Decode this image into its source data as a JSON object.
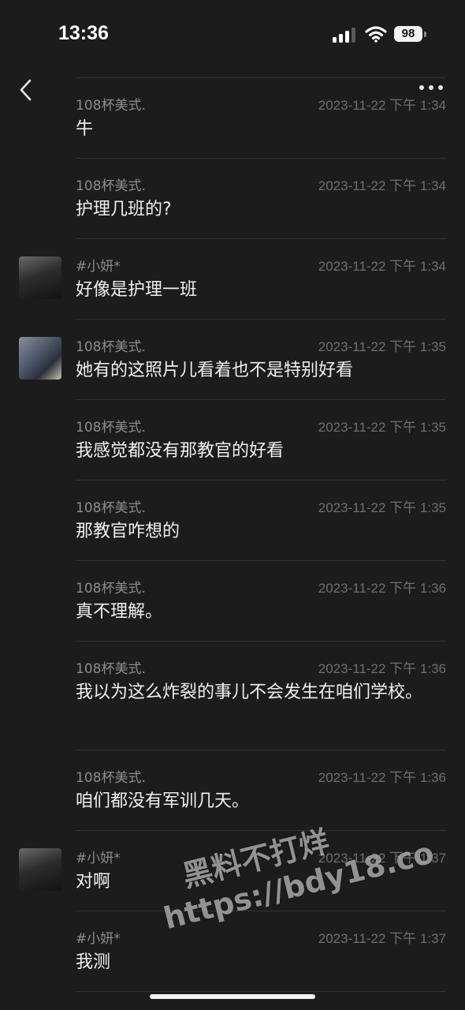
{
  "status": {
    "time": "13:36",
    "battery": "98"
  },
  "messages": [
    {
      "name": "108杯美式.",
      "time": "2023-11-22 下午 1:34",
      "text": "牛",
      "avatar": ""
    },
    {
      "name": "108杯美式.",
      "time": "2023-11-22 下午 1:34",
      "text": "护理几班的?",
      "avatar": ""
    },
    {
      "name": "#小妍*",
      "time": "2023-11-22 下午 1:34",
      "text": "好像是护理一班",
      "avatar": "dark-portrait"
    },
    {
      "name": "108杯美式.",
      "time": "2023-11-22 下午 1:35",
      "text": "她有的这照片儿看着也不是特别好看",
      "avatar": "photo-portrait"
    },
    {
      "name": "108杯美式.",
      "time": "2023-11-22 下午 1:35",
      "text": "我感觉都没有那教官的好看",
      "avatar": ""
    },
    {
      "name": "108杯美式.",
      "time": "2023-11-22 下午 1:35",
      "text": "那教官咋想的",
      "avatar": ""
    },
    {
      "name": "108杯美式.",
      "time": "2023-11-22 下午 1:36",
      "text": "真不理解。",
      "avatar": ""
    },
    {
      "name": "108杯美式.",
      "time": "2023-11-22 下午 1:36",
      "text": "我以为这么炸裂的事儿不会发生在咱们学校。",
      "avatar": ""
    },
    {
      "name": "108杯美式.",
      "time": "2023-11-22 下午 1:36",
      "text": "咱们都没有军训几天。",
      "avatar": ""
    },
    {
      "name": "#小妍*",
      "time": "2023-11-22 下午 1:37",
      "text": "对啊",
      "avatar": "dark-portrait"
    },
    {
      "name": "#小妍*",
      "time": "2023-11-22 下午 1:37",
      "text": "我测",
      "avatar": ""
    }
  ],
  "watermark": {
    "line1": "黑料不打烊",
    "line2": "https://bdy18.co"
  },
  "icons": {
    "back": "chevron-left-icon",
    "more": "ellipsis-icon",
    "signal": "signal-icon",
    "wifi": "wifi-icon",
    "battery": "battery-icon"
  }
}
